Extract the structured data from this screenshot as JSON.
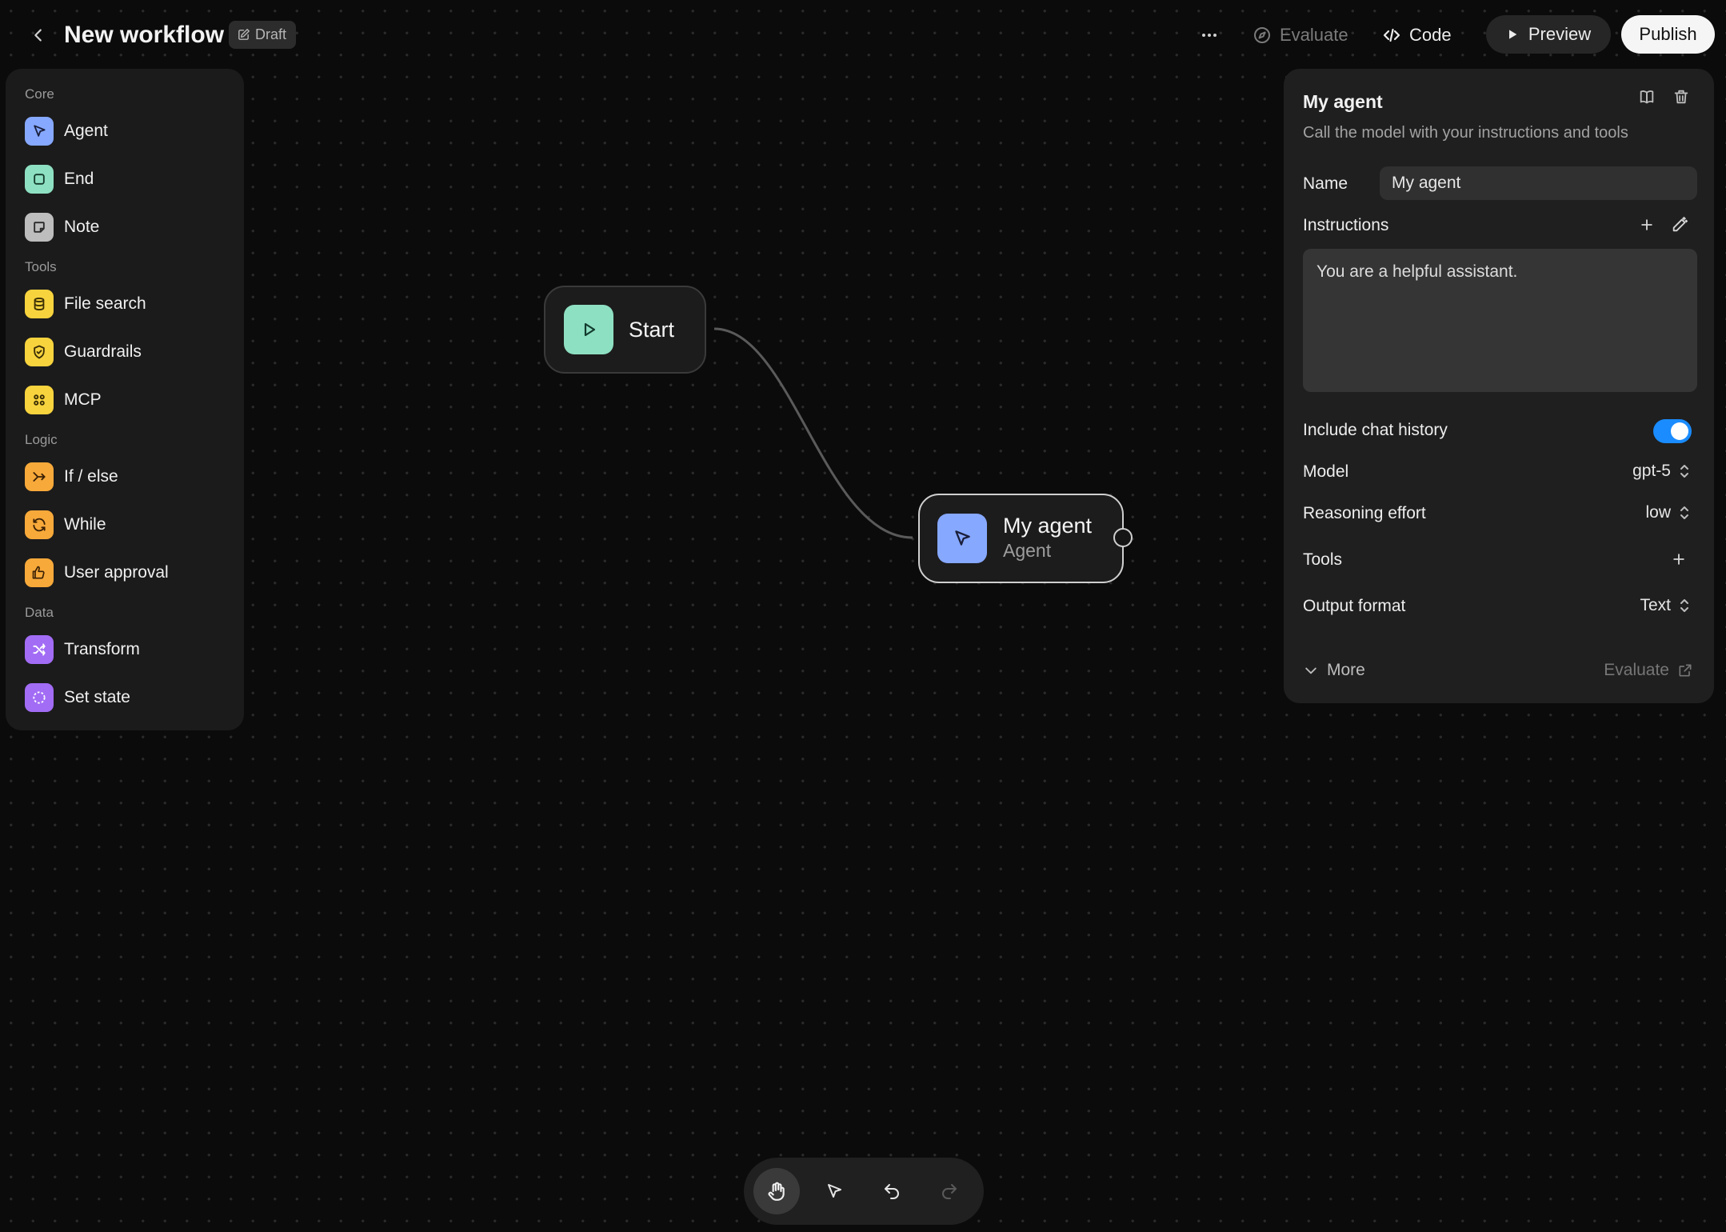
{
  "header": {
    "title": "New workflow",
    "badge": "Draft",
    "evaluate_label": "Evaluate",
    "code_label": "Code",
    "preview_label": "Preview",
    "publish_label": "Publish"
  },
  "palette": {
    "sections": [
      "Core",
      "Tools",
      "Logic",
      "Data"
    ],
    "items": [
      {
        "label": "Agent",
        "icon": "agent-icon",
        "color": "#86a8ff"
      },
      {
        "label": "End",
        "icon": "end-icon",
        "color": "#8ee0c2"
      },
      {
        "label": "Note",
        "icon": "note-icon",
        "color": "#bdbdbd"
      },
      {
        "label": "File search",
        "icon": "database-icon",
        "color": "#f7d33e"
      },
      {
        "label": "Guardrails",
        "icon": "shield-icon",
        "color": "#f7d33e"
      },
      {
        "label": "MCP",
        "icon": "mcp-icon",
        "color": "#f7d33e"
      },
      {
        "label": "If / else",
        "icon": "branch-icon",
        "color": "#f7a93a"
      },
      {
        "label": "While",
        "icon": "loop-icon",
        "color": "#f7a93a"
      },
      {
        "label": "User approval",
        "icon": "thumbs-icon",
        "color": "#f7a93a"
      },
      {
        "label": "Transform",
        "icon": "shuffle-icon",
        "color": "#a26cf5"
      },
      {
        "label": "Set state",
        "icon": "dashed-circle-icon",
        "color": "#a26cf5"
      }
    ]
  },
  "canvas": {
    "start_node": {
      "title": "Start"
    },
    "agent_node": {
      "title": "My agent",
      "subtitle": "Agent"
    }
  },
  "inspector": {
    "title": "My agent",
    "description": "Call the model with your instructions and tools",
    "name_label": "Name",
    "name_value": "My agent",
    "instructions_label": "Instructions",
    "instructions_value": "You are a helpful assistant.",
    "chat_history_label": "Include chat history",
    "chat_history_enabled": true,
    "model_label": "Model",
    "model_value": "gpt-5",
    "reasoning_label": "Reasoning effort",
    "reasoning_value": "low",
    "tools_label": "Tools",
    "output_label": "Output format",
    "output_value": "Text",
    "more_label": "More",
    "evaluate_label": "Evaluate"
  },
  "toolbar": {
    "tools": [
      "hand-icon",
      "pointer-icon",
      "undo-icon",
      "redo-icon"
    ],
    "active_tool": "hand-icon"
  },
  "colors": {
    "accent_toggle": "#1a8cff",
    "start_node": "#8ee0c2",
    "agent_node": "#86a8ff"
  }
}
